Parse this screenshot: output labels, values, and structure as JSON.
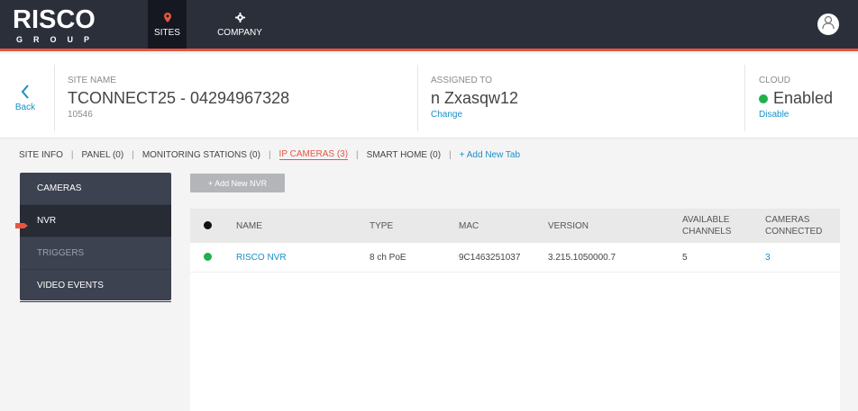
{
  "app": {
    "brand": "RISCO",
    "brand_sub": "GROUP",
    "nav": [
      {
        "label": "SITES",
        "icon": "map-pin-icon",
        "active": true
      },
      {
        "label": "COMPANY",
        "icon": "gear-icon",
        "active": false
      }
    ],
    "accent": "#e8563f",
    "nav_bg": "#2b2f3a"
  },
  "header": {
    "back_label": "Back",
    "site_name_label": "SITE NAME",
    "site_name": "TCONNECT25 - 04294967328",
    "site_id": "10546",
    "assigned_label": "ASSIGNED TO",
    "assigned_value": "n Zxasqw12",
    "change_label": "Change",
    "cloud_label": "CLOUD",
    "cloud_status": "Enabled",
    "cloud_status_color": "#20b14a",
    "disable_label": "Disable"
  },
  "tabs": {
    "items": [
      {
        "label": "SITE INFO"
      },
      {
        "label": "PANEL (0)"
      },
      {
        "label": "MONITORING STATIONS (0)"
      },
      {
        "label": "IP CAMERAS (3)",
        "active": true
      },
      {
        "label": "SMART HOME (0)"
      }
    ],
    "add_label": "+ Add New Tab"
  },
  "sidemenu": {
    "items": [
      {
        "label": "CAMERAS"
      },
      {
        "label": "NVR",
        "active": true
      },
      {
        "label": "TRIGGERS"
      },
      {
        "label": "VIDEO EVENTS"
      }
    ]
  },
  "main": {
    "add_button": "+ Add New NVR",
    "table": {
      "columns": {
        "name": "NAME",
        "type": "TYPE",
        "mac": "MAC",
        "version": "VERSION",
        "available_l1": "AVAILABLE",
        "available_l2": "CHANNELS",
        "connected_l1": "CAMERAS",
        "connected_l2": "CONNECTED"
      },
      "rows": [
        {
          "status_color": "#20b14a",
          "name": "RISCO NVR",
          "type": "8 ch PoE",
          "mac": "9C1463251037",
          "version": "3.215.1050000.7",
          "available": "5",
          "connected": "3"
        }
      ]
    }
  }
}
